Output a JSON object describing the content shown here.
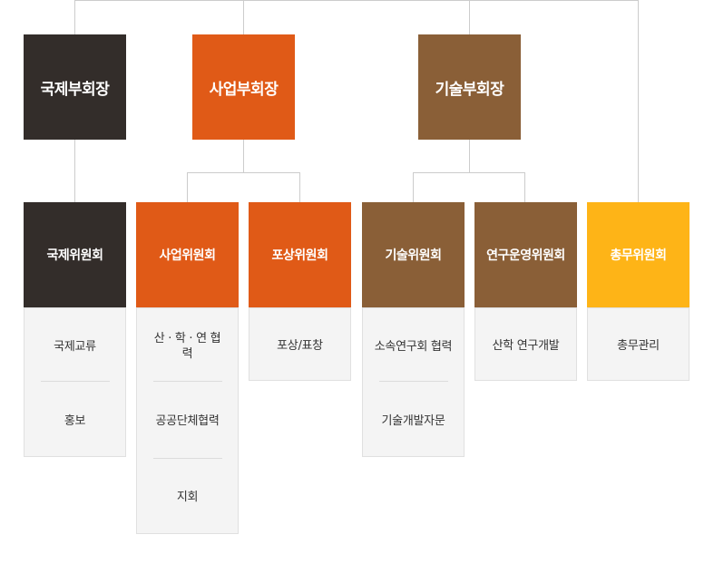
{
  "vice_presidents": [
    {
      "label": "국제부회장",
      "color": "#332d2a"
    },
    {
      "label": "사업부회장",
      "color": "#e05a17"
    },
    {
      "label": "기술부회장",
      "color": "#8a5f37"
    }
  ],
  "committees": [
    {
      "label": "국제위원회",
      "color": "#332d2a",
      "items": [
        "국제교류",
        "홍보"
      ]
    },
    {
      "label": "사업위원회",
      "color": "#e05a17",
      "items": [
        "산 · 학 · 연 협력",
        "공공단체협력",
        "지회"
      ]
    },
    {
      "label": "포상위원회",
      "color": "#e05a17",
      "items": [
        "포상/표창"
      ]
    },
    {
      "label": "기술위원회",
      "color": "#8a5f37",
      "items": [
        "소속연구회 협력",
        "기술개발자문"
      ]
    },
    {
      "label": "연구운영위원회",
      "color": "#8a5f37",
      "items": [
        "산학 연구개발"
      ]
    },
    {
      "label": "총무위원회",
      "color": "#feb417",
      "items": [
        "총무관리"
      ]
    }
  ]
}
